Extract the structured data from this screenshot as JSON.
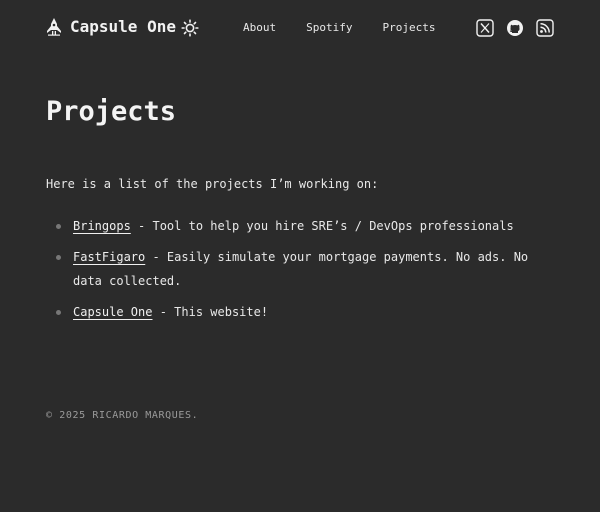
{
  "header": {
    "brand_title": "Capsule One",
    "brand_icon": "rocket-icon",
    "theme_icon": "sun-icon",
    "nav": [
      {
        "label": "About"
      },
      {
        "label": "Spotify"
      },
      {
        "label": "Projects"
      }
    ],
    "socials": [
      {
        "icon": "x-twitter-icon"
      },
      {
        "icon": "github-icon"
      },
      {
        "icon": "rss-icon"
      }
    ]
  },
  "main": {
    "title": "Projects",
    "intro": "Here is a list of the projects I’m working on:",
    "projects": [
      {
        "name": "Bringops",
        "description": " - Tool to help you hire SRE’s / DevOps professionals"
      },
      {
        "name": "FastFigaro",
        "description": " - Easily simulate your mortgage payments. No ads. No data collected."
      },
      {
        "name": "Capsule One",
        "description": " - This website!"
      }
    ]
  },
  "footer": {
    "copyright": "© 2025 RICARDO MARQUES."
  },
  "colors": {
    "background": "#2b2b2b",
    "text": "#e8e8e8",
    "muted": "#9a9a9a",
    "bullet": "#777777"
  }
}
